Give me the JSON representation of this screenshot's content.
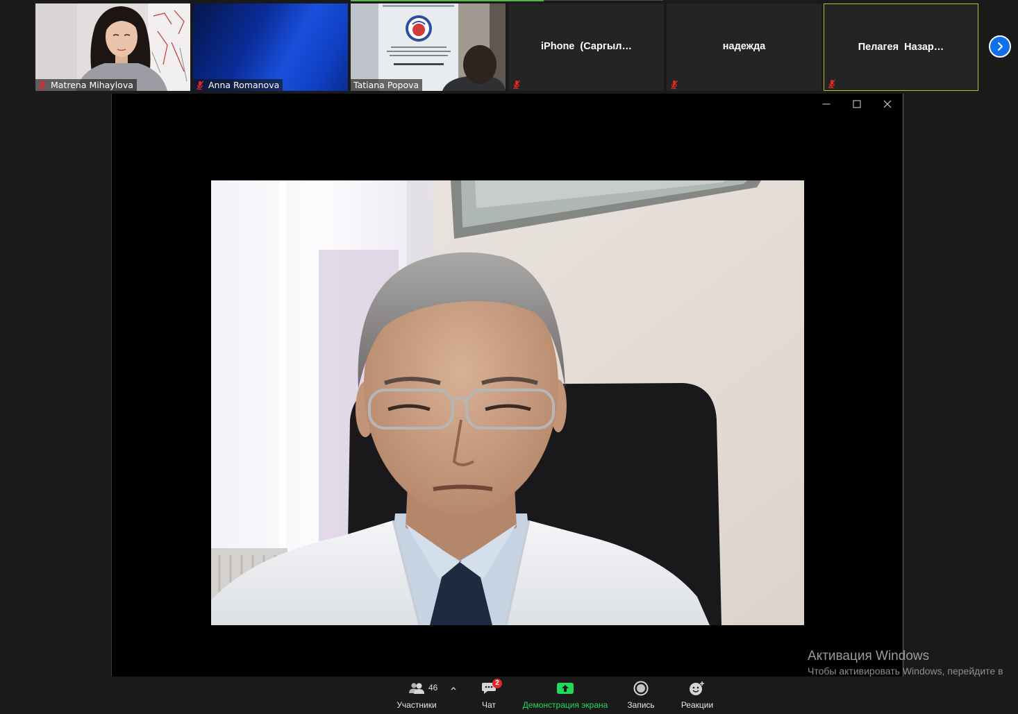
{
  "participants": [
    {
      "name": "Matrena Mihaylova",
      "video": true,
      "muted": true
    },
    {
      "name": "Anna Romanova",
      "video": true,
      "muted": true
    },
    {
      "name": "Tatiana Popova",
      "video": true,
      "muted": false
    },
    {
      "name": "iPhone  (Саргыл…",
      "video": false,
      "muted": true
    },
    {
      "name": "надежда",
      "video": false,
      "muted": true
    },
    {
      "name": "Пелагея  Назар…",
      "video": false,
      "muted": true,
      "active_speaker": true
    }
  ],
  "filmstrip": {
    "next_icon": "chevron-right-icon"
  },
  "window_controls": {
    "minimize_icon": "minimize-icon",
    "maximize_icon": "maximize-icon",
    "close_icon": "close-icon"
  },
  "toolbar": {
    "participants": {
      "label": "Участники",
      "count": "46",
      "icon": "participants-icon",
      "options_icon": "chevron-up-icon"
    },
    "chat": {
      "label": "Чат",
      "badge": "2",
      "icon": "chat-icon"
    },
    "share_screen": {
      "label": "Демонстрация экрана",
      "icon": "share-screen-icon"
    },
    "record": {
      "label": "Запись",
      "icon": "record-icon"
    },
    "reactions": {
      "label": "Реакции",
      "icon": "reactions-icon"
    }
  },
  "watermark": {
    "title": "Активация Windows",
    "subtitle": "Чтобы активировать Windows, перейдите в"
  },
  "icons": {
    "muted": "mic-muted-icon"
  },
  "colors": {
    "background": "#1a1a1a",
    "video_panel": "#000000",
    "active_speaker_border": "#a7c43a",
    "accent_blue": "#0e71eb",
    "share_green": "#23d959",
    "muted_red": "#e02828",
    "badge_red": "#e02828"
  }
}
